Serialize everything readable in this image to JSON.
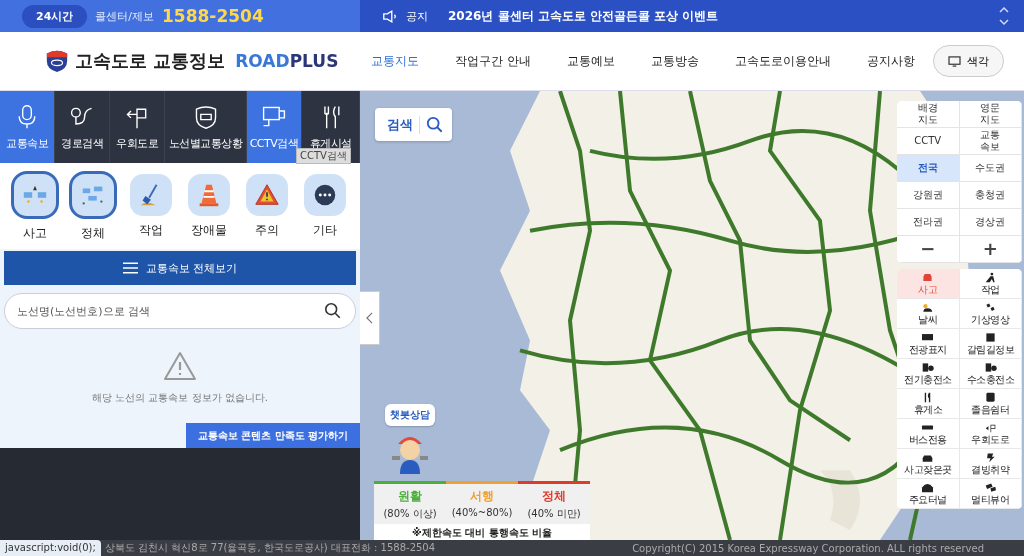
{
  "top_bar": {
    "badge": "24시간",
    "label": "콜센터/제보",
    "phone": "1588-2504",
    "notice_label": "공지",
    "notice": "2026년 콜센터 고속도로 안전골든콜 포상 이벤트"
  },
  "header": {
    "logo_text": "고속도로 교통정보",
    "brand_light": "ROAD",
    "brand_dark": "PLUS",
    "display_button": "색각"
  },
  "nav": [
    {
      "label": "교통지도",
      "selected": true
    },
    {
      "label": "작업구간 안내",
      "selected": false
    },
    {
      "label": "교통예보",
      "selected": false
    },
    {
      "label": "교통방송",
      "selected": false
    },
    {
      "label": "고속도로이용안내",
      "selected": false
    },
    {
      "label": "공지사항",
      "selected": false
    }
  ],
  "side_tabs": [
    {
      "label": "교통속보",
      "selected": true
    },
    {
      "label": "경로검색",
      "selected": false
    },
    {
      "label": "우회도로",
      "selected": false
    },
    {
      "label": "노선별교통상황",
      "selected": false
    },
    {
      "label": "CCTV검색",
      "selected": true
    },
    {
      "label": "휴게시설",
      "selected": false
    }
  ],
  "tooltip": "CCTV검색",
  "categories": [
    {
      "label": "사고",
      "selected": true
    },
    {
      "label": "정체",
      "selected": true
    },
    {
      "label": "작업",
      "selected": false
    },
    {
      "label": "장애물",
      "selected": false
    },
    {
      "label": "주의",
      "selected": false
    },
    {
      "label": "기타",
      "selected": false
    }
  ],
  "all_button": "교통속보 전체보기",
  "route_search": {
    "placeholder": "노선명(노선번호)으로 검색"
  },
  "empty_message": "해당 노선의 교통속보 정보가 없습니다.",
  "feedback_button": "교통속보 콘텐츠 만족도 평가하기",
  "map": {
    "search_button": "검색",
    "layers": [
      {
        "label": "배경\n지도",
        "selected": false
      },
      {
        "label": "영문\n지도",
        "selected": false
      },
      {
        "label": "CCTV",
        "selected": false
      },
      {
        "label": "교통\n속보",
        "selected": false
      },
      {
        "label": "전국",
        "selected": true
      },
      {
        "label": "수도권",
        "selected": false
      },
      {
        "label": "강원권",
        "selected": false
      },
      {
        "label": "충청권",
        "selected": false
      },
      {
        "label": "전라권",
        "selected": false
      },
      {
        "label": "경상권",
        "selected": false
      }
    ],
    "zoom_out": "−",
    "zoom_in": "+",
    "pois": [
      {
        "label": "사고",
        "selected": true
      },
      {
        "label": "작업",
        "selected": false
      },
      {
        "label": "날씨",
        "selected": false
      },
      {
        "label": "기상영상",
        "selected": false
      },
      {
        "label": "전광표지",
        "selected": false
      },
      {
        "label": "갈림길정보",
        "selected": false
      },
      {
        "label": "전기충전소",
        "selected": false
      },
      {
        "label": "수소충전소",
        "selected": false
      },
      {
        "label": "휴게소",
        "selected": false
      },
      {
        "label": "졸음쉼터",
        "selected": false
      },
      {
        "label": "버스전용",
        "selected": false
      },
      {
        "label": "우회도로",
        "selected": false
      },
      {
        "label": "사고잦은곳",
        "selected": false
      },
      {
        "label": "결빙취약",
        "selected": false
      },
      {
        "label": "주요터널",
        "selected": false
      },
      {
        "label": "멀티뷰어",
        "selected": false
      }
    ],
    "chatbot": "챗봇상담",
    "legend": [
      {
        "name": "원활",
        "range": "(80% 이상)",
        "color": "#4caf3c"
      },
      {
        "name": "서행",
        "range": "(40%~80%)",
        "color": "#f0a030"
      },
      {
        "name": "정체",
        "range": "(40% 미만)",
        "color": "#e03a2a"
      }
    ],
    "legend_note": "※제한속도 대비 통행속도 비율"
  },
  "footer": {
    "address": "상북도 김천시 혁신8로 77(율곡동, 한국도로공사) 대표전화 : 1588-2504",
    "copyright": "Copyright(C) 2015 Korea Expressway Corporation. ALL rights reserved"
  },
  "status_url": "javascript:void(0);"
}
